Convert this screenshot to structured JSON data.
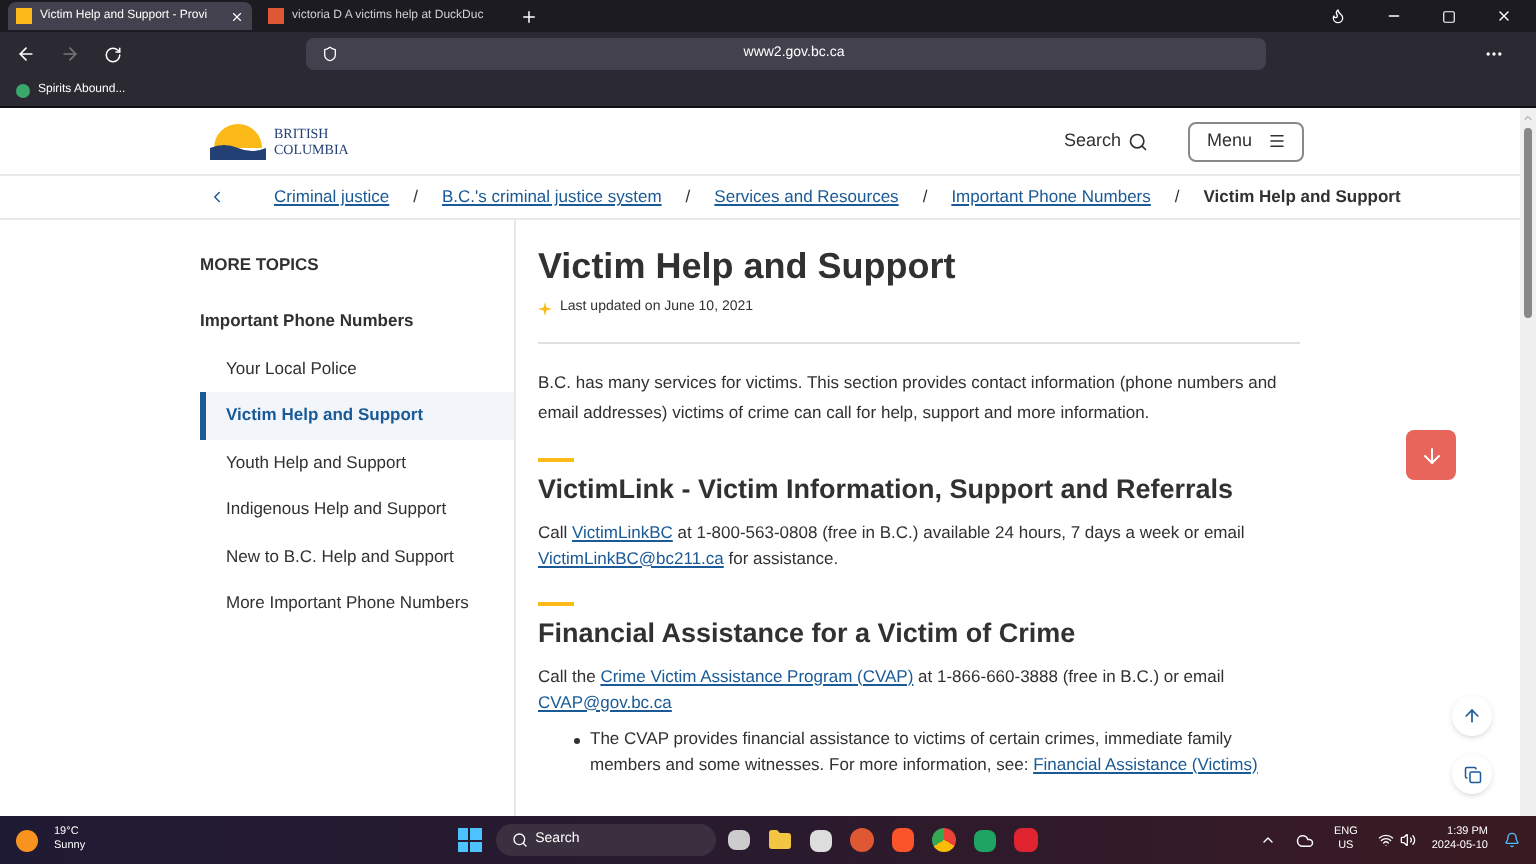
{
  "browser": {
    "tabs": [
      {
        "title": "Victim Help and Support - Provi",
        "selected": true
      },
      {
        "title": "victoria D A victims help at DuckDuc",
        "selected": false
      }
    ],
    "url": "www2.gov.bc.ca",
    "bookmarks": [
      "Spirits Abound..."
    ]
  },
  "header": {
    "logo_lines": [
      "BRITISH",
      "COLUMBIA"
    ],
    "search": "Search",
    "menu": "Menu"
  },
  "breadcrumb": {
    "links": [
      "Criminal justice",
      "B.C.'s criminal justice system",
      "Services and Resources",
      "Important Phone Numbers"
    ],
    "current": "Victim Help and Support",
    "separator": "/"
  },
  "sidebar": {
    "heading": "MORE TOPICS",
    "parent": "Important Phone Numbers",
    "items": [
      {
        "label": "Your Local Police",
        "selected": false
      },
      {
        "label": "Victim Help and Support",
        "selected": true
      },
      {
        "label": "Youth Help and Support",
        "selected": false
      },
      {
        "label": "Indigenous Help and Support",
        "selected": false
      },
      {
        "label": "New to B.C. Help and Support",
        "selected": false
      },
      {
        "label": "More Important Phone Numbers",
        "selected": false
      }
    ]
  },
  "article": {
    "title": "Victim Help and Support",
    "updated": "Last updated on June 10, 2021",
    "intro": [
      "B.C. has many services for victims. This section provides contact information (phone numbers and email addresses) victims of crime can call for help, support and more information."
    ],
    "sections": [
      {
        "heading": "VictimLink - Victim Information, Support and Referrals",
        "paragraphs": [
          [
            "Call ",
            {
              "link": "VictimLinkBC"
            },
            " at 1-800-563-0808 (free in B.C.) available 24 hours, 7 days a week or email ",
            {
              "link": "VictimLinkBC@bc211.ca"
            },
            " for assistance."
          ]
        ]
      },
      {
        "heading": "Financial Assistance for a Victim of Crime",
        "paragraphs": [
          [
            "Call the ",
            {
              "link": "Crime Victim Assistance Program (CVAP)"
            },
            " at 1-866-660-3888 (free in B.C.) or email ",
            {
              "link": "CVAP@gov.bc.ca"
            }
          ]
        ],
        "bullets": [
          [
            "The CVAP provides financial assistance to victims of certain crimes, immediate family members and some witnesses. For more information, see: ",
            {
              "link": "Financial Assistance (Victims)"
            }
          ]
        ]
      }
    ]
  },
  "taskbar": {
    "weather_temp": "19°C",
    "weather_text": "Sunny",
    "search": "Search",
    "lang": "ENG",
    "region": "US",
    "time": "1:39 PM",
    "date": "2024-05-10"
  }
}
